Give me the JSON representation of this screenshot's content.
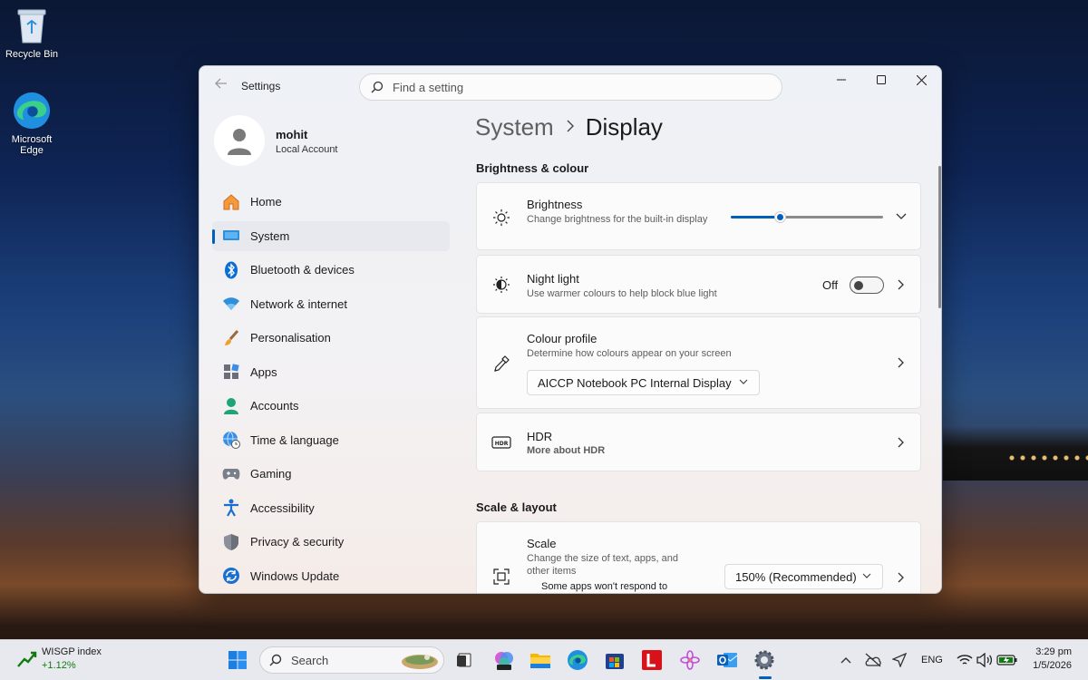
{
  "desktop": {
    "icons": [
      {
        "label": "Recycle Bin"
      },
      {
        "label": "Microsoft Edge"
      }
    ]
  },
  "window": {
    "app_title": "Settings",
    "search_placeholder": "Find a setting",
    "profile": {
      "name": "mohit",
      "account_type": "Local Account"
    },
    "nav": [
      {
        "label": "Home",
        "icon": "home-icon"
      },
      {
        "label": "System",
        "icon": "monitor-icon",
        "active": true
      },
      {
        "label": "Bluetooth & devices",
        "icon": "bluetooth-icon"
      },
      {
        "label": "Network & internet",
        "icon": "wifi-icon"
      },
      {
        "label": "Personalisation",
        "icon": "paintbrush-icon"
      },
      {
        "label": "Apps",
        "icon": "apps-icon"
      },
      {
        "label": "Accounts",
        "icon": "person-icon"
      },
      {
        "label": "Time & language",
        "icon": "globe-clock-icon"
      },
      {
        "label": "Gaming",
        "icon": "gamepad-icon"
      },
      {
        "label": "Accessibility",
        "icon": "accessibility-icon"
      },
      {
        "label": "Privacy & security",
        "icon": "shield-icon"
      },
      {
        "label": "Windows Update",
        "icon": "update-icon"
      }
    ],
    "breadcrumb": {
      "parent": "System",
      "current": "Display"
    },
    "sections": {
      "brightness_colour": "Brightness & colour",
      "scale_layout": "Scale & layout"
    },
    "brightness": {
      "title": "Brightness",
      "desc": "Change brightness for the built-in display",
      "level_fraction": 0.32
    },
    "night_light": {
      "title": "Night light",
      "desc": "Use warmer colours to help block blue light",
      "state": "Off"
    },
    "colour_profile": {
      "title": "Colour profile",
      "desc": "Determine how colours appear on your screen",
      "selected": "AICCP Notebook PC Internal Display"
    },
    "hdr": {
      "title": "HDR",
      "link": "More about HDR"
    },
    "scale": {
      "title": "Scale",
      "desc": "Change the size of text, apps, and other items",
      "selected": "150% (Recommended)",
      "note": "Some apps won't respond to"
    }
  },
  "taskbar": {
    "widget": {
      "title": "WISGP index",
      "value": "+1.12%"
    },
    "search_label": "Search",
    "language": "ENG",
    "time": "3:29 pm",
    "date": "1/5/2026"
  },
  "colors": {
    "accent": "#005fb8",
    "link": "#003e92",
    "stock_green": "#107c10"
  }
}
